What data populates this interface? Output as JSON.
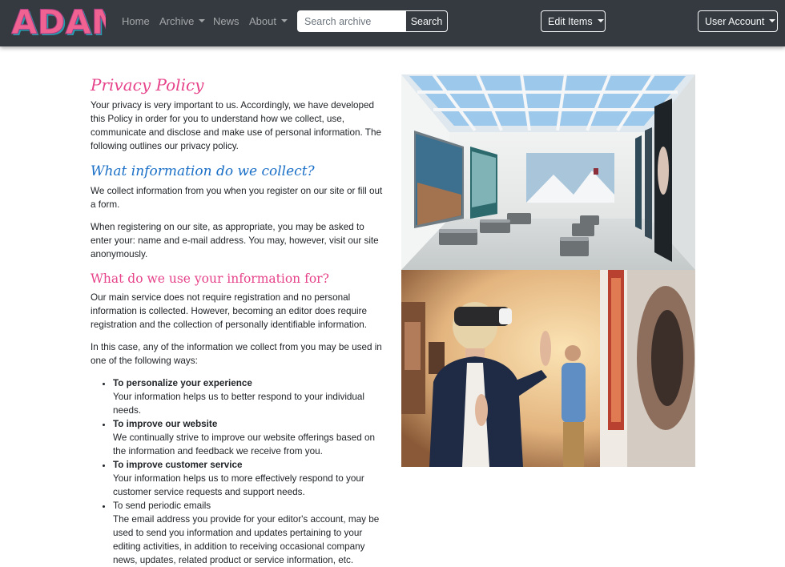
{
  "navbar": {
    "logo_text": "ADAM",
    "links": [
      {
        "label": "Home"
      },
      {
        "label": "Archive"
      },
      {
        "label": "News"
      },
      {
        "label": "About"
      }
    ],
    "search": {
      "placeholder": "Search archive",
      "button_label": "Search"
    },
    "edit_items_label": "Edit Items",
    "user_account_label": "User Account"
  },
  "policy": {
    "title": "Privacy Policy",
    "intro": "Your privacy is very important to us. Accordingly, we have developed this Policy in order for you to understand how we collect, use, communicate and disclose and make use of personal information. The following outlines our privacy policy.",
    "collect_heading": "What information do we collect?",
    "collect_p1": "We collect information from you when you register on our site or fill out a form.",
    "collect_p2": "When registering on our site, as appropriate, you may be asked to enter your: name and e-mail address. You may, however, visit our site anonymously.",
    "use_heading": "What do we use your information for?",
    "use_p1": "Our main service does not require registration and no personal information is collected. However, becoming an editor does require registration and the collection of personally identifiable information.",
    "use_p2": "In this case, any of the information we collect from you may be used in one of the following ways:",
    "uses": [
      {
        "title": "To personalize your experience",
        "text": "Your information helps us to better respond to your individual needs."
      },
      {
        "title": "To improve our website",
        "text": "We continually strive to improve our website offerings based on the information and feedback we receive from you."
      },
      {
        "title": "To improve customer service",
        "text": "Your information helps us to more effectively respond to your customer service requests and support needs."
      },
      {
        "title": "To send periodic emails",
        "text": "The email address you provide for your editor's account, may be used to send you information and updates pertaining to your editing activities, in addition to receiving occasional company news, updates, related product or service information, etc."
      }
    ]
  },
  "colors": {
    "navbar_bg": "#343a40",
    "heading_pink": "#e6438a",
    "heading_blue": "#1a6fc7",
    "logo_fill": "#f06292",
    "logo_stroke": "#22b8cf"
  },
  "icons": [
    "dropdown-caret-icon"
  ]
}
